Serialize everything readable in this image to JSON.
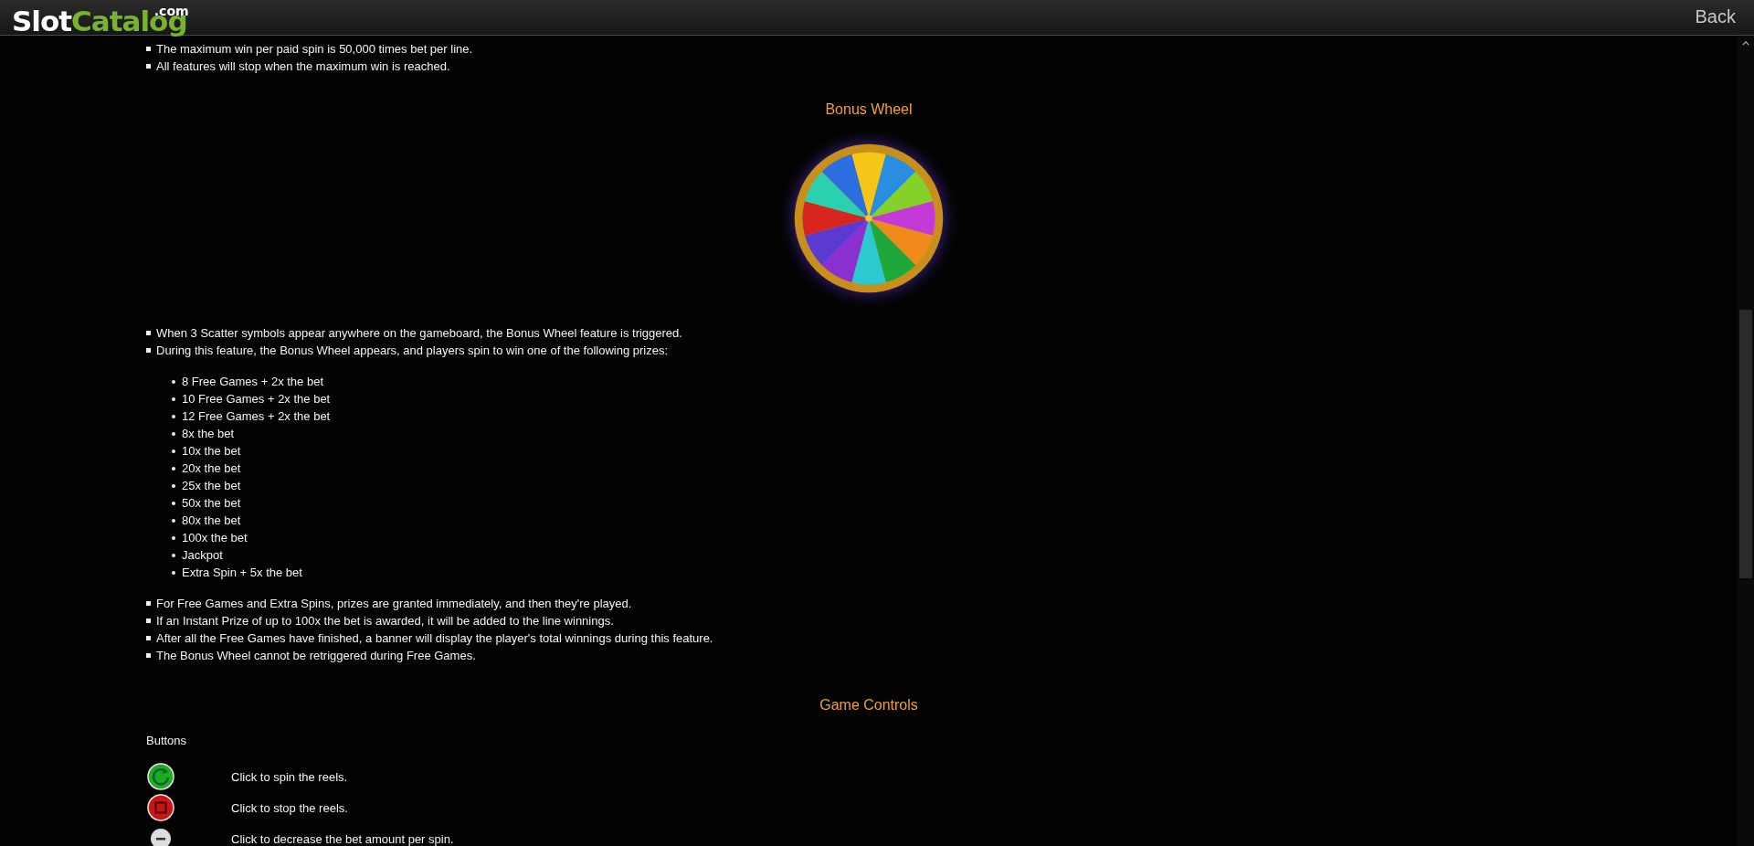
{
  "header": {
    "logo": {
      "main": "Slot",
      "accent": "Catalog",
      "suffix": ".com"
    },
    "back": "Back"
  },
  "intro_bullets": [
    "The maximum win per paid spin is 50,000 times bet per line.",
    "All features will stop when the maximum win is reached."
  ],
  "bonus_wheel": {
    "heading": "Bonus Wheel",
    "image": {
      "kind": "picture"
    },
    "bullets": [
      "When 3 Scatter symbols appear anywhere on the gameboard, the Bonus Wheel feature is triggered.",
      "During this feature, the Bonus Wheel appears, and players spin to win one of the following prizes:"
    ],
    "prizes": [
      "8 Free Games + 2x the bet",
      "10 Free Games + 2x the bet",
      "12 Free Games + 2x the bet",
      "8x the bet",
      "10x the bet",
      "20x the bet",
      "25x the bet",
      "50x the bet",
      "80x the bet",
      "100x the bet",
      "Jackpot",
      "Extra Spin + 5x the bet"
    ],
    "notes": [
      "For Free Games and Extra Spins, prizes are granted immediately, and then they're played.",
      "If an Instant Prize of up to 100x the bet is awarded, it will be added to the line winnings.",
      "After all the Free Games have finished, a banner will display the player's total winnings during this feature.",
      "The Bonus Wheel cannot be retriggered during Free Games."
    ]
  },
  "game_controls": {
    "heading": "Game Controls",
    "subheading": "Buttons",
    "buttons": [
      {
        "kind": "spin",
        "text": "Click to spin the reels."
      },
      {
        "kind": "stop",
        "text": "Click to stop the reels."
      },
      {
        "kind": "minus",
        "text": "Click to decrease the bet amount per spin."
      }
    ]
  }
}
